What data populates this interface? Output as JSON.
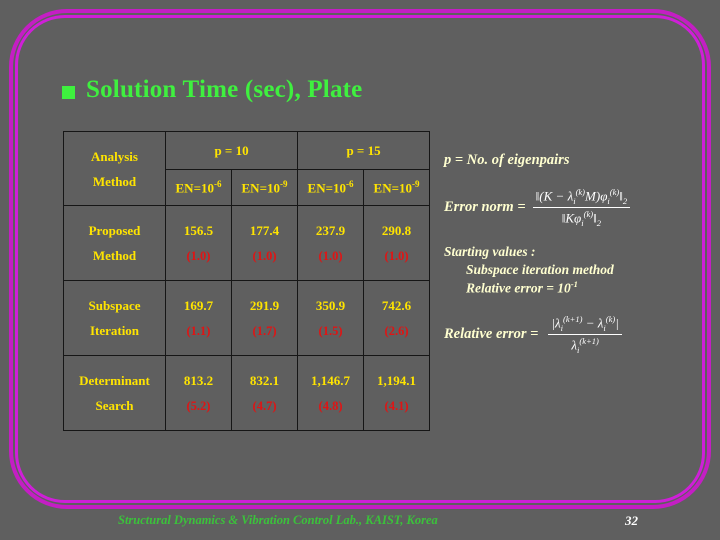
{
  "slide": {
    "title": "Solution Time (sec), Plate",
    "bullet_icon": "square-bullet-icon",
    "accent_green": "#3ff03f",
    "accent_yellow": "#ffe400",
    "accent_red": "#e01414",
    "border_color": "#cf1fd8",
    "background": "#5f5f5f"
  },
  "table": {
    "header": {
      "row_label_line1": "Analysis",
      "row_label_line2": "Method",
      "groups": [
        {
          "label": "p = 10",
          "span": 2
        },
        {
          "label": "p = 15",
          "span": 2
        }
      ],
      "subheaders": [
        {
          "base": "EN=10",
          "exp": "-6"
        },
        {
          "base": "EN=10",
          "exp": "-9"
        },
        {
          "base": "EN=10",
          "exp": "-6"
        },
        {
          "base": "EN=10",
          "exp": "-9"
        }
      ]
    },
    "rows": [
      {
        "method_line1": "Proposed",
        "method_line2": "Method",
        "values": [
          "156.5",
          "177.4",
          "237.9",
          "290.8"
        ],
        "ratios": [
          "(1.0)",
          "(1.0)",
          "(1.0)",
          "(1.0)"
        ]
      },
      {
        "method_line1": "Subspace",
        "method_line2": "Iteration",
        "values": [
          "169.7",
          "291.9",
          "350.9",
          "742.6"
        ],
        "ratios": [
          "(1.1)",
          "(1.7)",
          "(1.5)",
          "(2.6)"
        ]
      },
      {
        "method_line1": "Determinant",
        "method_line2": "Search",
        "values": [
          "813.2",
          "832.1",
          "1,146.7",
          "1,194.1"
        ],
        "ratios": [
          "(5.2)",
          "(4.7)",
          "(4.8)",
          "(4.1)"
        ]
      }
    ]
  },
  "annotations": {
    "eigenpairs_note": "p = No. of eigenpairs",
    "error_norm_label": "Error norm  =",
    "error_norm_numerator": "||(K − λi(k) M)φi(k)||2",
    "error_norm_denominator": "||Kφi(k)||2",
    "starting_values_title": "Starting values :",
    "starting_values_line1": "Subspace iteration method",
    "starting_values_line2": "Relative error = 10-1",
    "relative_error_label": "Relative error =",
    "relative_error_numerator": "|λi(k+1) − λi(k)|",
    "relative_error_denominator": "λi(k+1)"
  },
  "footer": {
    "lab": "Structural Dynamics & Vibration Control Lab., KAIST, Korea",
    "page_number": "32"
  }
}
